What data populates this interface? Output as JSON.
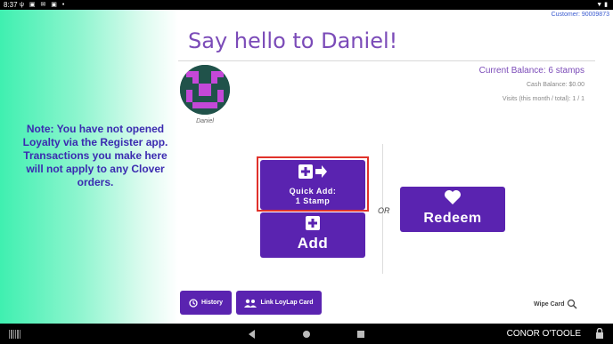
{
  "status_bar": {
    "time": "8:37"
  },
  "customer_label": "Customer: 90009873",
  "greeting": "Say hello to Daniel!",
  "avatar_name": "Daniel",
  "balance": {
    "current": "Current Balance: 6 stamps",
    "cash": "Cash Balance: $0.00",
    "visits": "Visits (this month / total): 1 / 1"
  },
  "note": "Note: You have not opened Loyalty via the Register app. Transactions you make here will not apply to any Clover orders.",
  "buttons": {
    "quick_add_line1": "Quick Add:",
    "quick_add_line2": "1 Stamp",
    "add": "Add",
    "or": "OR",
    "redeem": "Redeem",
    "history": "History",
    "link_card": "Link LoyLap Card",
    "wipe_card": "Wipe Card"
  },
  "nav": {
    "user": "CONOR O'TOOLE"
  },
  "colors": {
    "brand_purple": "#5a23b0",
    "green_panel": "#3ff0b0",
    "highlight_red": "#e0322b"
  }
}
